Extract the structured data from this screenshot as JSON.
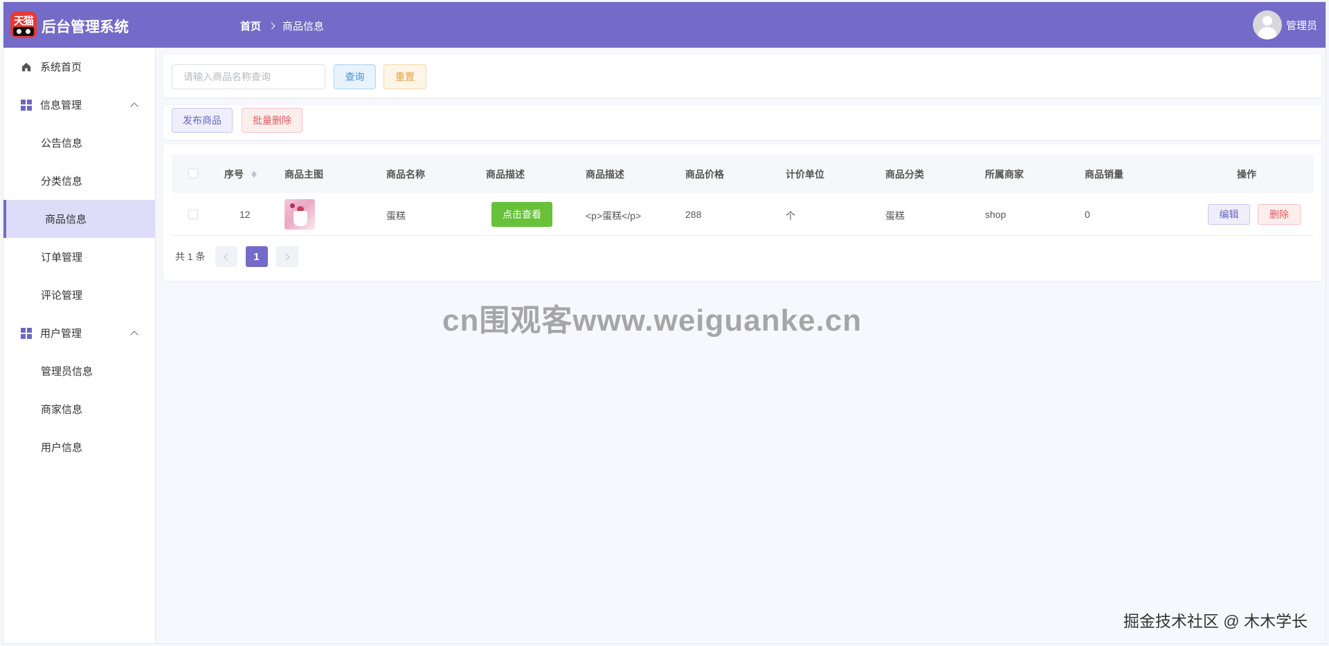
{
  "header": {
    "logo_text": "天猫",
    "app_title": "后台管理系统",
    "breadcrumb": {
      "home": "首页",
      "current": "商品信息"
    },
    "user": {
      "name": "管理员"
    },
    "bg_color": "#736bc7"
  },
  "sidebar": {
    "items": [
      {
        "label": "系统首页",
        "icon": "home-icon"
      },
      {
        "label": "信息管理",
        "icon": "grid-icon",
        "expanded": true
      },
      {
        "label": "公告信息"
      },
      {
        "label": "分类信息"
      },
      {
        "label": "商品信息",
        "active": true
      },
      {
        "label": "订单管理"
      },
      {
        "label": "评论管理"
      },
      {
        "label": "用户管理",
        "icon": "grid-icon",
        "expanded": true
      },
      {
        "label": "管理员信息"
      },
      {
        "label": "商家信息"
      },
      {
        "label": "用户信息"
      }
    ]
  },
  "search": {
    "placeholder": "请输入商品名称查询",
    "value": "",
    "query_label": "查询",
    "reset_label": "重置"
  },
  "toolbar": {
    "add_label": "发布商品",
    "batch_delete_label": "批量删除"
  },
  "table": {
    "columns": [
      "序号",
      "商品主图",
      "商品名称",
      "商品描述",
      "商品描述",
      "商品价格",
      "计价单位",
      "商品分类",
      "所属商家",
      "商品销量",
      "操作"
    ],
    "rows": [
      {
        "id": "12",
        "name": "蛋糕",
        "view_label": "点击查看",
        "desc_raw": "<p>蛋糕</p>",
        "price": "288",
        "unit": "个",
        "category": "蛋糕",
        "merchant": "shop",
        "sales": "0",
        "edit_label": "编辑",
        "delete_label": "删除"
      }
    ]
  },
  "pager": {
    "total": "共 1 条",
    "current_page": "1"
  },
  "watermark": "cn围观客www.weiguanke.cn",
  "credit": "掘金技术社区 @ 木木学长"
}
